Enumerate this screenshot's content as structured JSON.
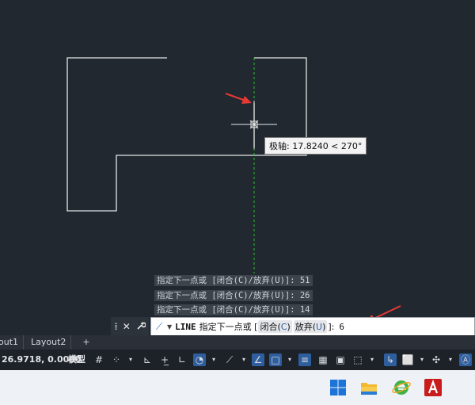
{
  "tooltip": {
    "text": "极轴: 17.8240 < 270°"
  },
  "command_history": [
    "指定下一点或 [闭合(C)/放弃(U)]: 51",
    "指定下一点或 [闭合(C)/放弃(U)]: 26",
    "指定下一点或 [闭合(C)/放弃(U)]: 14"
  ],
  "command_line": {
    "close_icon": "✕",
    "settings_icon": "wrench-icon",
    "command_name": "LINE",
    "prompt": "指定下一点或 [",
    "option_close": "闭合",
    "option_close_key": "C",
    "option_undo": "放弃",
    "option_undo_key": "U",
    "prompt_end": "]:",
    "typed_value": "6"
  },
  "layout_tabs": [
    {
      "label": "out1"
    },
    {
      "label": "Layout2"
    }
  ],
  "add_tab": "+",
  "status_bar": {
    "coordinates": "26.9718, 0.0000",
    "model_label": "模型"
  },
  "colors": {
    "canvas_bg": "#212830",
    "geometry": "#e6e6e6",
    "polar_tracking": "#27c22b",
    "arrow": "#e53935",
    "accent": "#2f5e9e"
  },
  "taskbar": {
    "apps": [
      "windows-start-icon",
      "file-explorer-icon",
      "browser-icon",
      "autocad-icon"
    ]
  }
}
